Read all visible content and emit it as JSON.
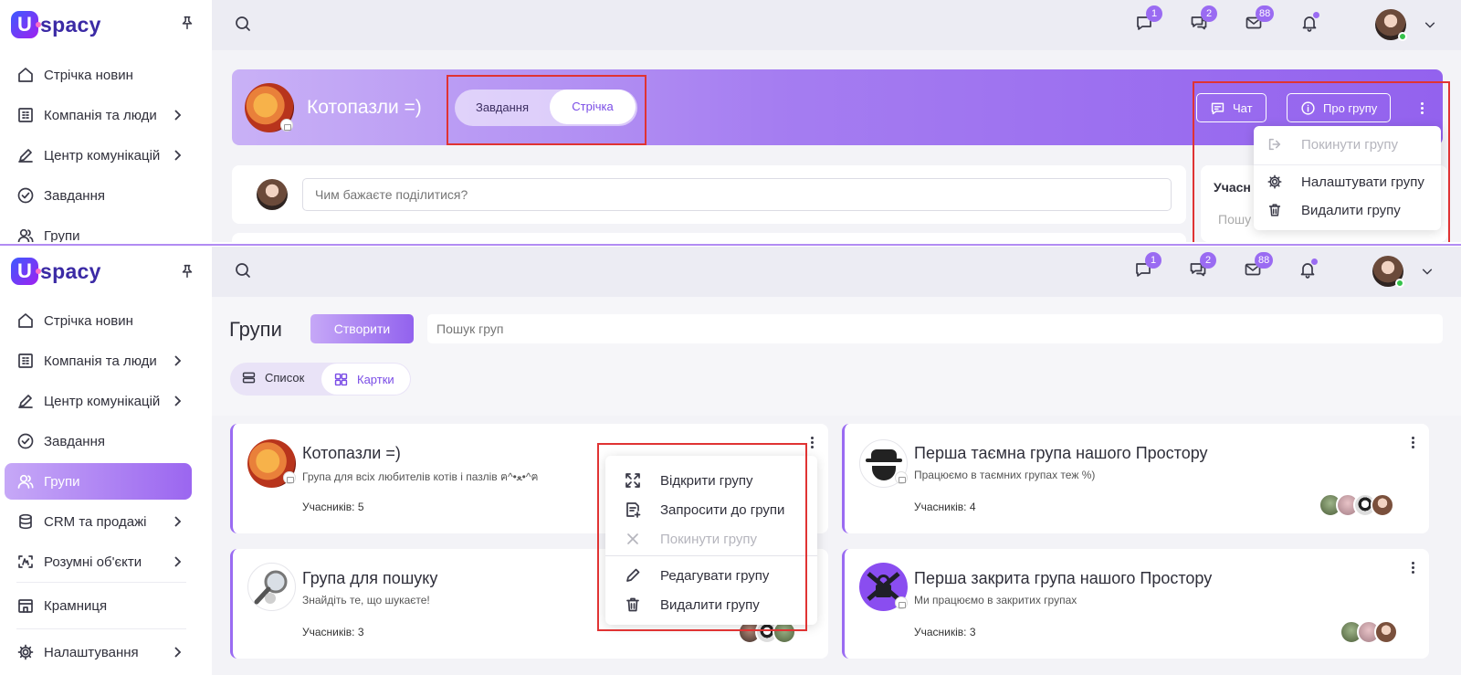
{
  "brand": {
    "letter": "U",
    "word": "spacy"
  },
  "colors": {
    "accent": "#9a6bf2",
    "highlight": "#e03333",
    "online": "#35c24a"
  },
  "sidebar_top": [
    {
      "label": "Стрічка новин",
      "icon": "home-icon",
      "chevron": false
    },
    {
      "label": "Компанія та люди",
      "icon": "company-icon",
      "chevron": true
    },
    {
      "label": "Центр комунікацій",
      "icon": "edit-icon",
      "chevron": true
    },
    {
      "label": "Завдання",
      "icon": "check-circle-icon",
      "chevron": false
    },
    {
      "label": "Групи",
      "icon": "users-icon",
      "chevron": false
    }
  ],
  "sidebar_bottom": [
    {
      "label": "Стрічка новин",
      "icon": "home-icon",
      "chevron": false,
      "active": false
    },
    {
      "label": "Компанія та люди",
      "icon": "company-icon",
      "chevron": true,
      "active": false
    },
    {
      "label": "Центр комунікацій",
      "icon": "edit-icon",
      "chevron": true,
      "active": false
    },
    {
      "label": "Завдання",
      "icon": "check-circle-icon",
      "chevron": false,
      "active": false
    },
    {
      "label": "Групи",
      "icon": "users-icon",
      "chevron": false,
      "active": true
    },
    {
      "label": "CRM та продажі",
      "icon": "database-icon",
      "chevron": true,
      "active": false
    },
    {
      "label": "Розумні об'єкти",
      "icon": "smart-object-icon",
      "chevron": true,
      "active": false
    },
    {
      "label": "Крамниця",
      "icon": "store-icon",
      "chevron": false,
      "active": false
    },
    {
      "label": "Налаштування",
      "icon": "gear-icon",
      "chevron": true,
      "active": false
    }
  ],
  "topbar": {
    "chat_badge": "1",
    "comments_badge": "2",
    "mail_badge": "88"
  },
  "group_header": {
    "name": "Котопазли =)",
    "tab_tasks": "Завдання",
    "tab_feed": "Стрічка",
    "chat_btn": "Чат",
    "about_btn": "Про групу",
    "post_placeholder": "Чим бажаєте поділитися?",
    "side_title": "Учасн",
    "side_search": "Пошу",
    "menu": {
      "leave": "Покинути групу",
      "settings": "Налаштувати групу",
      "delete": "Видалити групу"
    }
  },
  "groups_page": {
    "title": "Групи",
    "create_btn": "Створити",
    "search_placeholder": "Пошук груп",
    "view_list": "Список",
    "view_cards": "Картки",
    "members_prefix": "Учасників:",
    "cards": [
      {
        "title": "Котопазли =)",
        "desc": "Група для всіх любителів котів і пазлів ฅ^•ﻌ•^ฅ",
        "members": "5"
      },
      {
        "title": "Перша таємна група нашого Простору",
        "desc": "Працюємо в таємних групах теж %)",
        "members": "4"
      },
      {
        "title": "Група для пошуку",
        "desc": "Знайдіть те, що шукаєте!",
        "members": "3"
      },
      {
        "title": "Перша закрита група нашого Простору",
        "desc": "Ми працюємо в закритих групах",
        "members": "3"
      }
    ],
    "context_menu": {
      "open": "Відкрити групу",
      "invite": "Запросити до групи",
      "leave": "Покинути групу",
      "edit": "Редагувати групу",
      "delete": "Видалити групу"
    }
  }
}
